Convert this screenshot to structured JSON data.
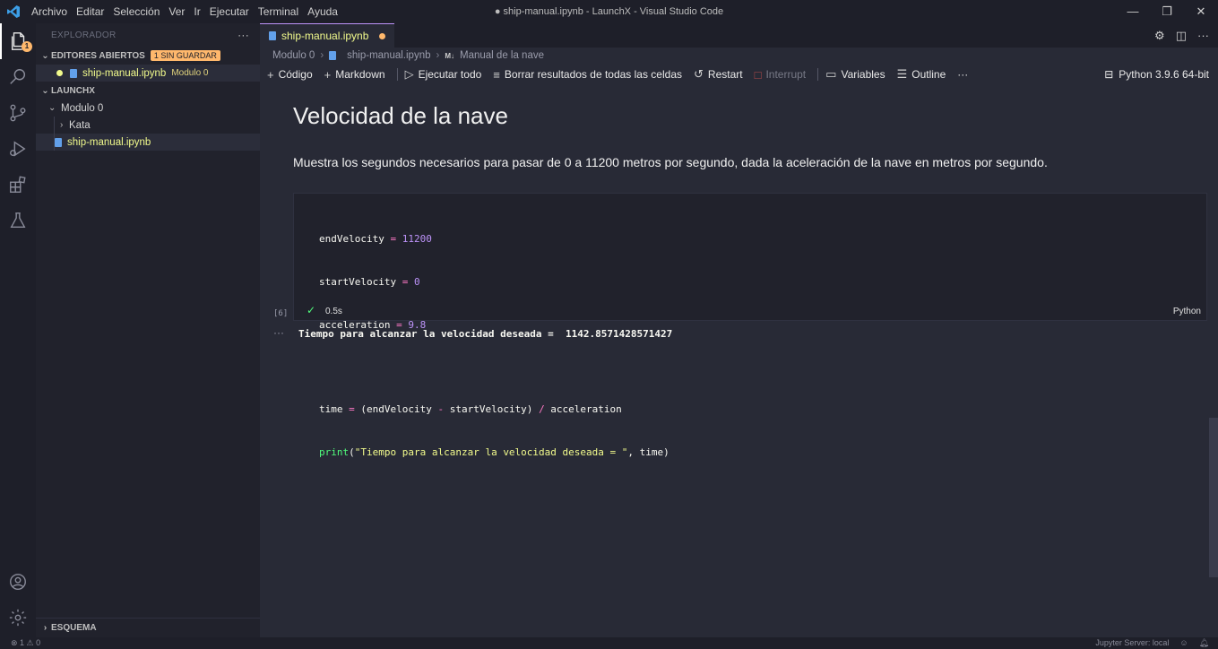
{
  "window": {
    "title": "● ship-manual.ipynb - LaunchX - Visual Studio Code",
    "controls": [
      "—",
      "❐",
      "✕"
    ]
  },
  "menu": [
    "Archivo",
    "Editar",
    "Selección",
    "Ver",
    "Ir",
    "Ejecutar",
    "Terminal",
    "Ayuda"
  ],
  "activity": {
    "explorer_badge": "1",
    "items": [
      "files-icon",
      "search-icon",
      "source-control-icon",
      "run-debug-icon",
      "extensions-icon",
      "testing-icon",
      "account-icon",
      "settings-gear-icon"
    ]
  },
  "sidebar": {
    "header": "EXPLORADOR",
    "more": "···",
    "open_editors": {
      "label": "EDITORES ABIERTOS",
      "badge": "1 SIN GUARDAR",
      "file": "ship-manual.ipynb",
      "folder": "Modulo 0"
    },
    "workspace": {
      "label": "LAUNCHX",
      "folder": "Modulo 0",
      "subfolder": "Kata",
      "file": "ship-manual.ipynb"
    },
    "outline": "ESQUEMA"
  },
  "tab": {
    "label": "ship-manual.ipynb"
  },
  "breadcrumb": {
    "items": [
      "Modulo 0",
      "ship-manual.ipynb"
    ],
    "md_marker": "M↓",
    "section": "Manual de la nave"
  },
  "toolbar": {
    "code": "Código",
    "markdown": "Markdown",
    "run_all": "Ejecutar todo",
    "clear": "Borrar resultados de todas las celdas",
    "restart": "Restart",
    "interrupt": "Interrupt",
    "variables": "Variables",
    "outline": "Outline",
    "more": "···",
    "kernel": "Python 3.9.6 64-bit"
  },
  "notebook": {
    "heading": "Velocidad de la nave",
    "description": "Muestra los segundos necesarios para pasar de 0 a 11200 metros por segundo, dada la aceleración de la nave en metros por segundo.",
    "cell": {
      "exec_count": "[6]",
      "duration": "0.5s",
      "language": "Python",
      "code_lines": [
        "endVelocity = 11200",
        "startVelocity = 0",
        "acceleration = 9.8",
        "",
        "time = (endVelocity - startVelocity) / acceleration",
        "print(\"Tiempo para alcanzar la velocidad deseada = \", time)"
      ]
    },
    "output_dots": "···",
    "output": "Tiempo para alcanzar la velocidad deseada =  1142.8571428571427"
  },
  "status": {
    "problems": "⊗ 1 ⚠ 0",
    "jupyter": "Jupyter Server: local"
  }
}
